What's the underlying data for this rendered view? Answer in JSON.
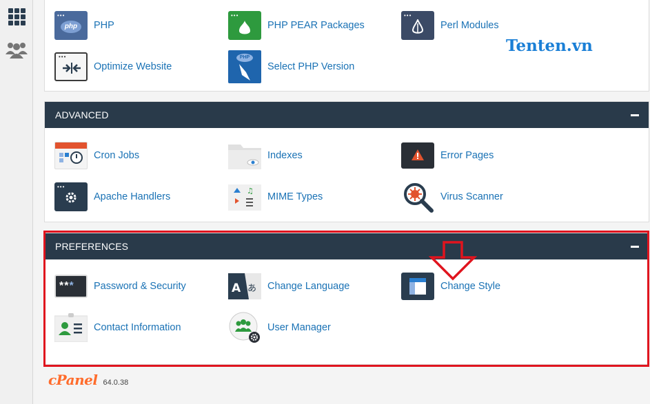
{
  "sidebar": {
    "items": [
      {
        "name": "home-grid",
        "icon": "grid-icon"
      },
      {
        "name": "users",
        "icon": "users-icon"
      }
    ]
  },
  "software": {
    "items": [
      {
        "label": "PHP",
        "icon": "php-icon"
      },
      {
        "label": "PHP PEAR Packages",
        "icon": "pear-icon"
      },
      {
        "label": "Perl Modules",
        "icon": "perl-icon"
      },
      {
        "label": "Optimize Website",
        "icon": "optimize-icon"
      },
      {
        "label": "Select PHP Version",
        "icon": "php-version-icon"
      }
    ]
  },
  "brand": {
    "text": "Tenten.vn",
    "color": "#1a7fd6"
  },
  "advanced": {
    "title": "ADVANCED",
    "items": [
      {
        "label": "Cron Jobs",
        "icon": "cron-icon"
      },
      {
        "label": "Indexes",
        "icon": "folder-eye-icon"
      },
      {
        "label": "Error Pages",
        "icon": "warning-icon"
      },
      {
        "label": "Apache Handlers",
        "icon": "gear-icon"
      },
      {
        "label": "MIME Types",
        "icon": "mime-icon"
      },
      {
        "label": "Virus Scanner",
        "icon": "virus-scanner-icon"
      }
    ]
  },
  "preferences": {
    "title": "PREFERENCES",
    "items": [
      {
        "label": "Password & Security",
        "icon": "password-icon"
      },
      {
        "label": "Change Language",
        "icon": "language-icon"
      },
      {
        "label": "Change Style",
        "icon": "style-icon"
      },
      {
        "label": "Contact Information",
        "icon": "contact-icon"
      },
      {
        "label": "User Manager",
        "icon": "user-manager-icon"
      }
    ]
  },
  "footer": {
    "logo": "cPanel",
    "version": "64.0.38"
  },
  "colors": {
    "header_bg": "#293a4a",
    "link": "#1a72b5",
    "highlight": "#e0141e",
    "cpanel_orange": "#ff6c2c"
  }
}
